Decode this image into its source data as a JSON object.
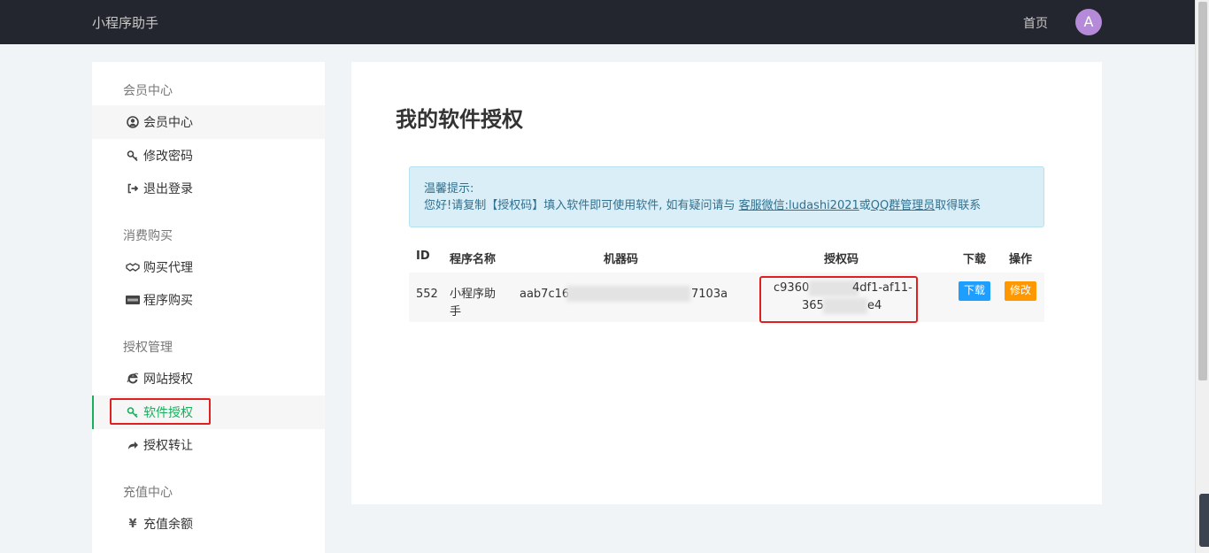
{
  "header": {
    "brand": "小程序助手",
    "home": "首页",
    "avatar_letter": "A"
  },
  "sidebar": {
    "sections": [
      {
        "title": "会员中心",
        "items": [
          {
            "label": "会员中心",
            "icon": "user-circle-icon"
          },
          {
            "label": "修改密码",
            "icon": "key-icon"
          },
          {
            "label": "退出登录",
            "icon": "sign-out-icon"
          }
        ]
      },
      {
        "title": "消费购买",
        "items": [
          {
            "label": "购买代理",
            "icon": "handshake-icon"
          },
          {
            "label": "程序购买",
            "icon": "paypal-icon"
          }
        ]
      },
      {
        "title": "授权管理",
        "items": [
          {
            "label": "网站授权",
            "icon": "ie-icon"
          },
          {
            "label": "软件授权",
            "icon": "key-icon"
          },
          {
            "label": "授权转让",
            "icon": "share-icon"
          }
        ]
      },
      {
        "title": "充值中心",
        "items": [
          {
            "label": "充值余额",
            "icon": "yen-icon"
          }
        ]
      }
    ]
  },
  "main": {
    "title": "我的软件授权",
    "notice": {
      "heading": "温馨提示:",
      "text_before": "您好!请复制【授权码】填入软件即可使用软件, 如有疑问请与 ",
      "link1": "客服微信:ludashi2021",
      "text_mid": "或",
      "link2": "QQ群管理员",
      "text_after": "取得联系"
    },
    "table": {
      "headers": {
        "id": "ID",
        "name": "程序名称",
        "machine": "机器码",
        "code": "授权码",
        "download": "下载",
        "action": "操作"
      },
      "row": {
        "id": "552",
        "name_line1": "小程序助",
        "name_line2": "手",
        "machine_prefix": "aab7c16",
        "machine_suffix": "7103a",
        "code_line1_prefix": "c9360",
        "code_line1_suffix": "4df1-af11-",
        "code_line2_prefix": "365",
        "code_line2_suffix": "e4",
        "download_btn": "下载",
        "edit_btn": "修改"
      }
    }
  },
  "colors": {
    "accent_green": "#1aaf5d",
    "btn_blue": "#1e9fff",
    "btn_orange": "#ff9800",
    "highlight_red": "#e01f1f"
  }
}
